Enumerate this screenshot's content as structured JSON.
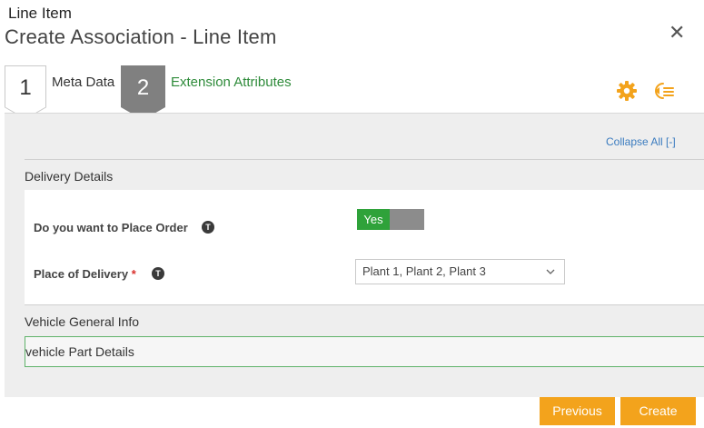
{
  "header": {
    "entity_type": "Line Item",
    "title": "Create Association - Line Item",
    "close_glyph": "✕"
  },
  "wizard": {
    "steps": [
      {
        "number": "1",
        "label": "Meta Data",
        "state": "completed"
      },
      {
        "number": "2",
        "label": "Extension Attributes",
        "state": "active"
      }
    ]
  },
  "toolbar": {
    "icons": [
      "gear-icon",
      "collapse-rows-icon"
    ],
    "accent_color": "#f3a31c"
  },
  "panel": {
    "collapse_all_label": "Collapse All [-]",
    "sections": [
      {
        "title": "Delivery Details",
        "fields": [
          {
            "label": "Do you want to Place Order",
            "required": false,
            "tooltip_glyph": "T",
            "type": "toggle",
            "value": "Yes"
          },
          {
            "label": "Place of Delivery",
            "required": true,
            "required_mark": "*",
            "tooltip_glyph": "T",
            "type": "select",
            "value": "Plant 1, Plant 2, Plant 3"
          }
        ]
      },
      {
        "title": "Vehicle General Info"
      },
      {
        "title": "vehicle Part Details"
      }
    ]
  },
  "footer": {
    "previous_label": "Previous",
    "create_label": "Create"
  },
  "colors": {
    "toggle_on": "#2fa23a",
    "toggle_off": "#8c8c8c",
    "active_step_text": "#2e8b3a",
    "link": "#3a7bbf",
    "button": "#f3a31c"
  }
}
